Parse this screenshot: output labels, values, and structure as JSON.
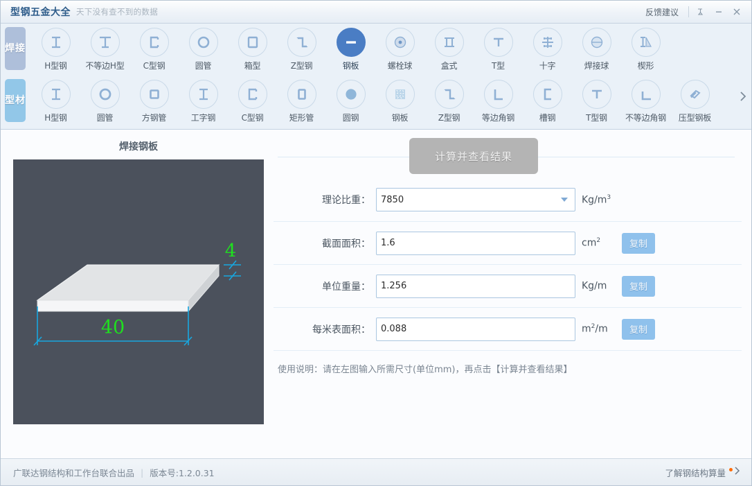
{
  "titlebar": {
    "app_title": "型钢五金大全",
    "subtitle": "天下没有查不到的数据",
    "feedback": "反馈建议",
    "pin_icon": "pin-icon",
    "minimize_icon": "minimize-icon",
    "close_icon": "close-icon"
  },
  "toolbar": {
    "rows": [
      {
        "tab_label": "焊接",
        "tab_name": "welded",
        "items": [
          {
            "label": "H型钢",
            "icon": "h-beam-icon",
            "active": false
          },
          {
            "label": "不等边H型",
            "icon": "unequal-h-beam-icon",
            "active": false
          },
          {
            "label": "C型钢",
            "icon": "c-channel-icon",
            "active": false
          },
          {
            "label": "圆管",
            "icon": "round-pipe-icon",
            "active": false
          },
          {
            "label": "箱型",
            "icon": "box-section-icon",
            "active": false
          },
          {
            "label": "Z型钢",
            "icon": "z-section-icon",
            "active": false
          },
          {
            "label": "钢板",
            "icon": "steel-plate-icon",
            "active": true
          },
          {
            "label": "螺栓球",
            "icon": "bolt-ball-icon",
            "active": false
          },
          {
            "label": "盒式",
            "icon": "box-type-icon",
            "active": false
          },
          {
            "label": "T型",
            "icon": "t-section-icon",
            "active": false
          },
          {
            "label": "十字",
            "icon": "cross-section-icon",
            "active": false
          },
          {
            "label": "焊接球",
            "icon": "welded-ball-icon",
            "active": false
          },
          {
            "label": "楔形",
            "icon": "wedge-icon",
            "active": false
          }
        ]
      },
      {
        "tab_label": "型材",
        "tab_name": "section",
        "items": [
          {
            "label": "H型钢",
            "icon": "h-beam-icon",
            "active": false
          },
          {
            "label": "圆管",
            "icon": "round-pipe-icon",
            "active": false
          },
          {
            "label": "方钢管",
            "icon": "square-tube-icon",
            "active": false
          },
          {
            "label": "工字钢",
            "icon": "i-beam-icon",
            "active": false
          },
          {
            "label": "C型钢",
            "icon": "c-channel-icon",
            "active": false
          },
          {
            "label": "矩形管",
            "icon": "rect-tube-icon",
            "active": false
          },
          {
            "label": "圆钢",
            "icon": "round-bar-icon",
            "active": false
          },
          {
            "label": "钢板",
            "icon": "checkered-plate-icon",
            "active": false
          },
          {
            "label": "Z型钢",
            "icon": "z-section-icon",
            "active": false
          },
          {
            "label": "等边角钢",
            "icon": "equal-angle-icon",
            "active": false
          },
          {
            "label": "槽钢",
            "icon": "channel-icon",
            "active": false
          },
          {
            "label": "T型钢",
            "icon": "t-steel-icon",
            "active": false
          },
          {
            "label": "不等边角钢",
            "icon": "unequal-angle-icon",
            "active": false
          },
          {
            "label": "压型钢板",
            "icon": "profiled-plate-icon",
            "active": false
          }
        ],
        "more_icon": "chevron-right-icon"
      }
    ]
  },
  "diagram": {
    "title": "焊接钢板",
    "dim_width": "40",
    "dim_thickness": "4"
  },
  "form": {
    "calculate_button": "计算并查看结果",
    "copy_label": "复制",
    "fields": [
      {
        "label": "理论比重：",
        "value": "7850",
        "unit_base": "Kg/m",
        "unit_sup": "3",
        "type": "select",
        "has_copy": false
      },
      {
        "label": "截面面积：",
        "value": "1.6",
        "unit_base": "cm",
        "unit_sup": "2",
        "type": "text",
        "has_copy": true
      },
      {
        "label": "单位重量：",
        "value": "1.256",
        "unit_base": "Kg/m",
        "unit_sup": "",
        "type": "text",
        "has_copy": true
      },
      {
        "label": "每米表面积：",
        "value": "0.088",
        "unit_base": "m",
        "unit_sup": "2",
        "unit_tail": "/m",
        "type": "text",
        "has_copy": true
      }
    ],
    "hint": "使用说明：请在左图输入所需尺寸(单位mm)，再点击【计算并查看结果】"
  },
  "footer": {
    "left": "广联达钢结构和工作台联合出品",
    "separator": "|",
    "version": "版本号:1.2.0.31",
    "right_link": "了解钢结构算量",
    "right_chevron": "chevron-right-icon"
  },
  "colors": {
    "brand_blue": "#4a7dc4",
    "tab_welded": "#aebfda",
    "tab_section": "#92c7e8",
    "copy_button": "#8fc1ec",
    "canvas_bg": "#4b515c",
    "dim_green": "#1fe01f",
    "dim_cyan": "#18a7e0",
    "badge_orange": "#ff6a00"
  }
}
